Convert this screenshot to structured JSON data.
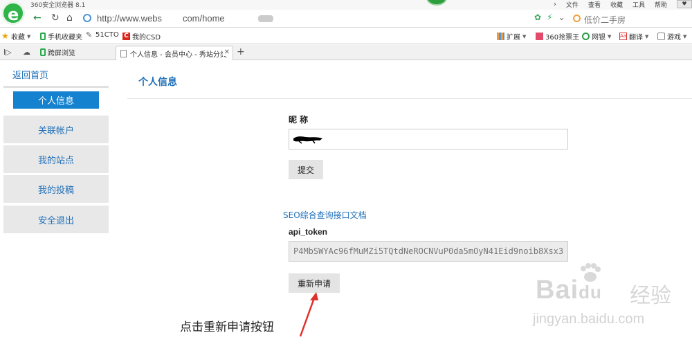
{
  "browser": {
    "app_title": "360安全浏览器 8.1",
    "menu": [
      "文件",
      "查看",
      "收藏",
      "工具",
      "帮助"
    ],
    "url_prefix": "http://www.webs",
    "url_suffix": "com/home",
    "search_placeholder": "低价二手房"
  },
  "bookmarks": {
    "favorites": "收藏",
    "mobile_favorites": "手机收藏夹",
    "site_51cto": "51CTO",
    "site_csd": "我的CSD",
    "extensions": "扩展",
    "ticket_king": "360抢票王",
    "bank": "网银",
    "translate": "翻译",
    "games": "游戏"
  },
  "tabs": {
    "mirror_label": "跨屏浏览",
    "active_title": "个人信息 - 会员中心 - 秀站分类"
  },
  "page": {
    "home_link": "返回首页",
    "sidebar": [
      "个人信息",
      "关联帐户",
      "我的站点",
      "我的投稿",
      "安全退出"
    ],
    "section_title": "个人信息",
    "nickname_label": "昵 称",
    "submit_label": "提交",
    "seo_doc_link": "SEO综合查询接口文档",
    "token_label": "api_token",
    "token_value": "P4MbSWYAc96fMuMZi5TQtdNeROCNVuP0da5mOyN41Eid9noib8Xsx3",
    "reapply_label": "重新申请"
  },
  "annotation": {
    "text": "点击重新申请按钮",
    "color": "#e0302a"
  },
  "watermark": {
    "brand": "Bai",
    "brand_du": "du",
    "cn": "经验",
    "url": "jingyan.baidu.com"
  },
  "colors": {
    "accent": "#1482cf",
    "link": "#1e6fb8",
    "menu_bg": "#e8e8e8"
  }
}
